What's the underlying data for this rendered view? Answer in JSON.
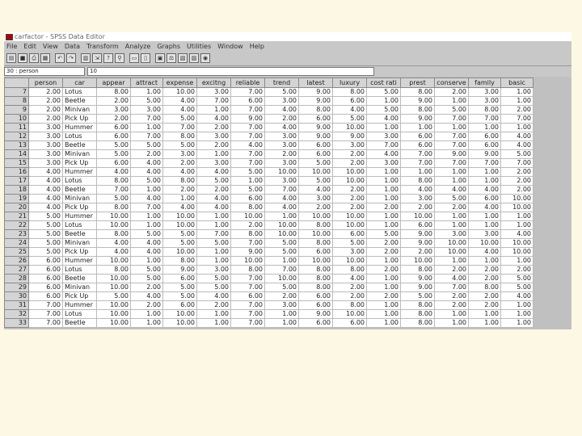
{
  "window": {
    "title": "carfactor - SPSS Data Editor"
  },
  "menu": [
    "File",
    "Edit",
    "View",
    "Data",
    "Transform",
    "Analyze",
    "Graphs",
    "Utilities",
    "Window",
    "Help"
  ],
  "toolbar": [
    "open-icon",
    "save-icon",
    "print-icon",
    "dialog-recall-icon",
    "undo-icon",
    "redo-icon",
    "goto-chart-icon",
    "goto-case-icon",
    "variables-icon",
    "find-icon",
    "insert-case-icon",
    "insert-variable-icon",
    "split-file-icon",
    "weight-cases-icon",
    "select-cases-icon",
    "value-labels-icon",
    "use-sets-icon"
  ],
  "cell_editor": {
    "ref": "30 : person",
    "value": "10"
  },
  "grid": {
    "columns": [
      "person",
      "car",
      "appear",
      "attract",
      "expense",
      "excitng",
      "reliable",
      "trend",
      "latest",
      "luxury",
      "cost rati",
      "prest",
      "conserve",
      "family",
      "basic"
    ],
    "rows": [
      [
        "7",
        "2.00",
        "Lotus",
        "8.00",
        "1.00",
        "10.00",
        "3.00",
        "7.00",
        "5.00",
        "9.00",
        "8.00",
        "5.00",
        "8.00",
        "2.00",
        "3.00",
        "1.00"
      ],
      [
        "8",
        "2.00",
        "Beetle",
        "2.00",
        "5.00",
        "4.00",
        "7.00",
        "6.00",
        "3.00",
        "9.00",
        "6.00",
        "1.00",
        "9.00",
        "1.00",
        "3.00",
        "1.00"
      ],
      [
        "9",
        "2.00",
        "Minivan",
        "3.00",
        "3.00",
        "4.00",
        "1.00",
        "7.00",
        "4.00",
        "8.00",
        "4.00",
        "5.00",
        "8.00",
        "5.00",
        "8.00",
        "2.00"
      ],
      [
        "10",
        "2.00",
        "Pick Up",
        "2.00",
        "7.00",
        "5.00",
        "4.00",
        "9.00",
        "2.00",
        "6.00",
        "5.00",
        "4.00",
        "9.00",
        "7.00",
        "7.00",
        "7.00"
      ],
      [
        "11",
        "3.00",
        "Hummer",
        "6.00",
        "1.00",
        "7.00",
        "2.00",
        "7.00",
        "4.00",
        "9.00",
        "10.00",
        "1.00",
        "1.00",
        "1.00",
        "1.00",
        "1.00"
      ],
      [
        "12",
        "3.00",
        "Lotus",
        "6.00",
        "7.00",
        "8.00",
        "3.00",
        "7.00",
        "3.00",
        "9.00",
        "9.00",
        "3.00",
        "6.00",
        "7.00",
        "6.00",
        "4.00"
      ],
      [
        "13",
        "3.00",
        "Beetle",
        "5.00",
        "5.00",
        "5.00",
        "2.00",
        "4.00",
        "3.00",
        "6.00",
        "3.00",
        "7.00",
        "6.00",
        "7.00",
        "6.00",
        "4.00"
      ],
      [
        "14",
        "3.00",
        "Minivan",
        "5.00",
        "2.00",
        "3.00",
        "1.00",
        "7.00",
        "2.00",
        "6.00",
        "2.00",
        "4.00",
        "7.00",
        "9.00",
        "9.00",
        "5.00"
      ],
      [
        "15",
        "3.00",
        "Pick Up",
        "6.00",
        "4.00",
        "2.00",
        "3.00",
        "7.00",
        "3.00",
        "5.00",
        "2.00",
        "3.00",
        "7.00",
        "7.00",
        "7.00",
        "7.00"
      ],
      [
        "16",
        "4.00",
        "Hummer",
        "4.00",
        "4.00",
        "4.00",
        "4.00",
        "5.00",
        "10.00",
        "10.00",
        "10.00",
        "1.00",
        "1.00",
        "1.00",
        "1.00",
        "2.00"
      ],
      [
        "17",
        "4.00",
        "Lotus",
        "8.00",
        "5.00",
        "8.00",
        "5.00",
        "1.00",
        "3.00",
        "5.00",
        "10.00",
        "1.00",
        "8.00",
        "1.00",
        "1.00",
        "2.00"
      ],
      [
        "18",
        "4.00",
        "Beetle",
        "7.00",
        "1.00",
        "2.00",
        "2.00",
        "5.00",
        "7.00",
        "4.00",
        "2.00",
        "1.00",
        "4.00",
        "4.00",
        "4.00",
        "2.00"
      ],
      [
        "19",
        "4.00",
        "Minivan",
        "5.00",
        "4.00",
        "1.00",
        "4.00",
        "6.00",
        "4.00",
        "3.00",
        "2.00",
        "1.00",
        "3.00",
        "5.00",
        "6.00",
        "10.00"
      ],
      [
        "20",
        "4.00",
        "Pick Up",
        "8.00",
        "7.00",
        "4.00",
        "4.00",
        "8.00",
        "4.00",
        "2.00",
        "2.00",
        "2.00",
        "2.00",
        "2.00",
        "4.00",
        "10.00"
      ],
      [
        "21",
        "5.00",
        "Hummer",
        "10.00",
        "1.00",
        "10.00",
        "1.00",
        "10.00",
        "1.00",
        "10.00",
        "10.00",
        "1.00",
        "10.00",
        "1.00",
        "1.00",
        "1.00"
      ],
      [
        "22",
        "5.00",
        "Lotus",
        "10.00",
        "1.00",
        "10.00",
        "1.00",
        "2.00",
        "10.00",
        "8.00",
        "10.00",
        "1.00",
        "6.00",
        "1.00",
        "1.00",
        "1.00"
      ],
      [
        "23",
        "5.00",
        "Beetle",
        "8.00",
        "5.00",
        "5.00",
        "7.00",
        "8.00",
        "10.00",
        "10.00",
        "6.00",
        "5.00",
        "9.00",
        "3.00",
        "3.00",
        "4.00"
      ],
      [
        "24",
        "5.00",
        "Minivan",
        "4.00",
        "4.00",
        "5.00",
        "5.00",
        "7.00",
        "5.00",
        "8.00",
        "5.00",
        "2.00",
        "9.00",
        "10.00",
        "10.00",
        "10.00"
      ],
      [
        "25",
        "5.00",
        "Pick Up",
        "4.00",
        "4.00",
        "10.00",
        "1.00",
        "9.00",
        "5.00",
        "6.00",
        "3.00",
        "2.00",
        "2.00",
        "10.00",
        "4.00",
        "10.00"
      ],
      [
        "26",
        "6.00",
        "Hummer",
        "10.00",
        "1.00",
        "8.00",
        "1.00",
        "10.00",
        "1.00",
        "10.00",
        "10.00",
        "1.00",
        "10.00",
        "1.00",
        "1.00",
        "1.00"
      ],
      [
        "27",
        "6.00",
        "Lotus",
        "8.00",
        "5.00",
        "9.00",
        "3.00",
        "8.00",
        "7.00",
        "8.00",
        "8.00",
        "2.00",
        "8.00",
        "2.00",
        "2.00",
        "2.00"
      ],
      [
        "28",
        "6.00",
        "Beetle",
        "10.00",
        "5.00",
        "6.00",
        "5.00",
        "7.00",
        "10.00",
        "8.00",
        "4.00",
        "1.00",
        "9.00",
        "4.00",
        "2.00",
        "5.00"
      ],
      [
        "29",
        "6.00",
        "Minivan",
        "10.00",
        "2.00",
        "5.00",
        "5.00",
        "7.00",
        "5.00",
        "8.00",
        "2.00",
        "1.00",
        "9.00",
        "7.00",
        "8.00",
        "5.00"
      ],
      [
        "30",
        "6.00",
        "Pick Up",
        "5.00",
        "4.00",
        "5.00",
        "4.00",
        "6.00",
        "2.00",
        "6.00",
        "2.00",
        "2.00",
        "5.00",
        "2.00",
        "2.00",
        "4.00"
      ],
      [
        "31",
        "7.00",
        "Hummer",
        "10.00",
        "2.00",
        "6.00",
        "2.00",
        "7.00",
        "3.00",
        "6.00",
        "8.00",
        "1.00",
        "8.00",
        "2.00",
        "2.00",
        "1.00"
      ],
      [
        "32",
        "7.00",
        "Lotus",
        "10.00",
        "1.00",
        "10.00",
        "1.00",
        "7.00",
        "1.00",
        "9.00",
        "10.00",
        "1.00",
        "8.00",
        "1.00",
        "1.00",
        "1.00"
      ],
      [
        "33",
        "7.00",
        "Beetle",
        "10.00",
        "1.00",
        "10.00",
        "1.00",
        "7.00",
        "1.00",
        "6.00",
        "6.00",
        "1.00",
        "8.00",
        "1.00",
        "1.00",
        "1.00"
      ]
    ]
  }
}
